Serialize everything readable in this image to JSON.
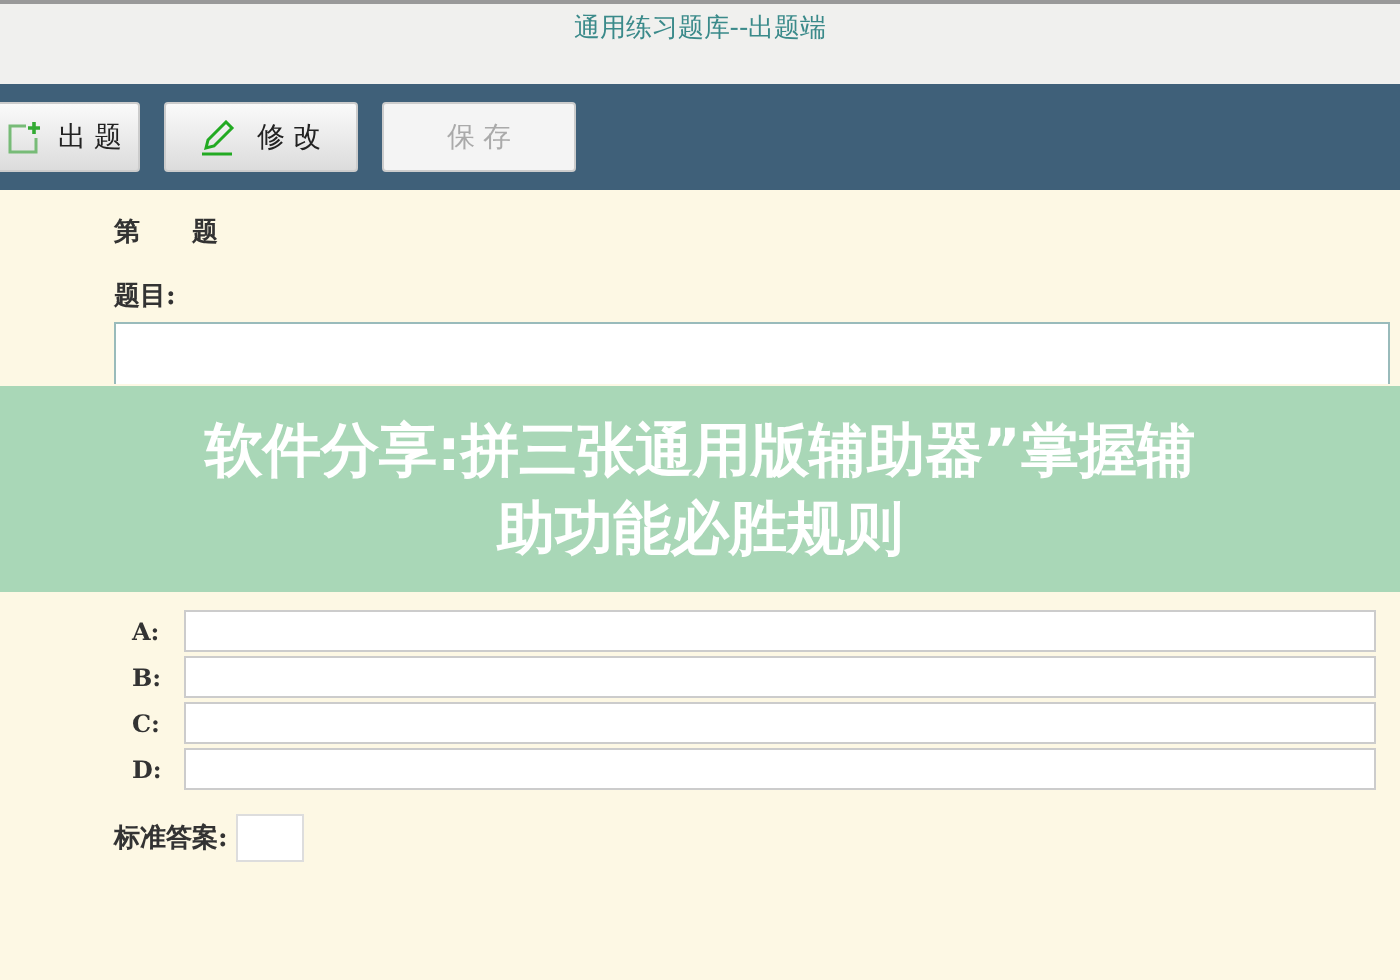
{
  "window": {
    "title": "通用练习题库--出题端"
  },
  "toolbar": [
    {
      "label": "出 题",
      "kind": "new",
      "disabled": false
    },
    {
      "label": "修 改",
      "kind": "edit",
      "disabled": false
    },
    {
      "label": "保 存",
      "kind": "save",
      "disabled": true
    }
  ],
  "form": {
    "heading": "第　　题",
    "question_label": "题目:",
    "options": [
      {
        "label": "A:"
      },
      {
        "label": "B:"
      },
      {
        "label": "C:"
      },
      {
        "label": "D:"
      }
    ],
    "answer_label": "标准答案:"
  },
  "banner": {
    "lines": [
      "软件分享:拼三张通用版辅助器”掌握辅",
      "助功能必胜规则"
    ]
  }
}
